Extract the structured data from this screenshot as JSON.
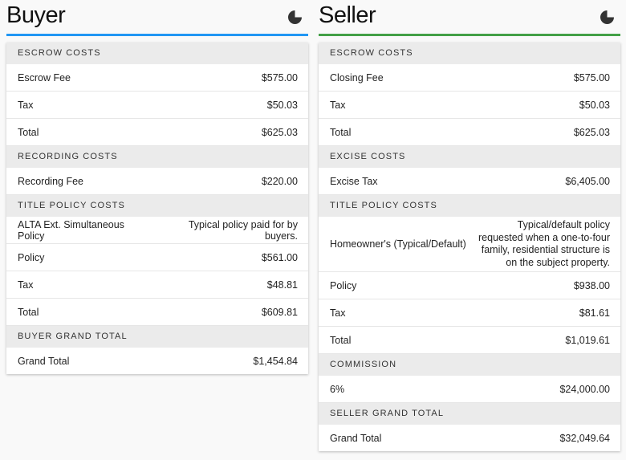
{
  "buyer": {
    "title": "Buyer",
    "sections": [
      {
        "heading": "ESCROW COSTS",
        "rows": [
          {
            "label": "Escrow Fee",
            "value": "$575.00"
          },
          {
            "label": "Tax",
            "value": "$50.03"
          },
          {
            "label": "Total",
            "value": "$625.03"
          }
        ]
      },
      {
        "heading": "RECORDING COSTS",
        "rows": [
          {
            "label": "Recording Fee",
            "value": "$220.00"
          }
        ]
      },
      {
        "heading": "TITLE POLICY COSTS",
        "rows": [
          {
            "label": "ALTA Ext. Simultaneous Policy",
            "value": "Typical policy paid for by buyers."
          },
          {
            "label": "Policy",
            "value": "$561.00"
          },
          {
            "label": "Tax",
            "value": "$48.81"
          },
          {
            "label": "Total",
            "value": "$609.81"
          }
        ]
      },
      {
        "heading": "BUYER GRAND TOTAL",
        "rows": [
          {
            "label": "Grand Total",
            "value": "$1,454.84"
          }
        ]
      }
    ]
  },
  "seller": {
    "title": "Seller",
    "sections": [
      {
        "heading": "ESCROW COSTS",
        "rows": [
          {
            "label": "Closing Fee",
            "value": "$575.00"
          },
          {
            "label": "Tax",
            "value": "$50.03"
          },
          {
            "label": "Total",
            "value": "$625.03"
          }
        ]
      },
      {
        "heading": "EXCISE COSTS",
        "rows": [
          {
            "label": "Excise Tax",
            "value": "$6,405.00"
          }
        ]
      },
      {
        "heading": "TITLE POLICY COSTS",
        "rows": [
          {
            "label": "Homeowner's (Typical/Default)",
            "value": "Typical/default policy requested when a one-to-four family, residential structure is on the subject property."
          },
          {
            "label": "Policy",
            "value": "$938.00"
          },
          {
            "label": "Tax",
            "value": "$81.61"
          },
          {
            "label": "Total",
            "value": "$1,019.61"
          }
        ]
      },
      {
        "heading": "COMMISSION",
        "rows": [
          {
            "label": "6%",
            "value": "$24,000.00"
          }
        ]
      },
      {
        "heading": "SELLER GRAND TOTAL",
        "rows": [
          {
            "label": "Grand Total",
            "value": "$32,049.64"
          }
        ]
      }
    ]
  },
  "icons": {
    "chart": "pie-chart-icon"
  }
}
